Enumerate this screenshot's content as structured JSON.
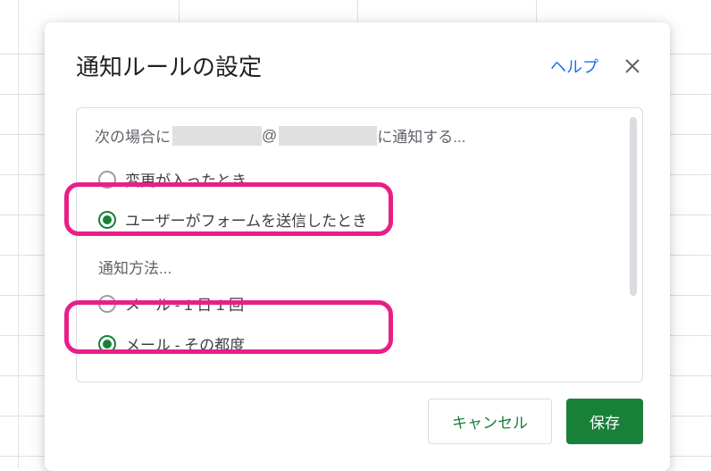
{
  "dialog": {
    "title": "通知ルールの設定",
    "help_label": "ヘルプ",
    "notify_prefix": "次の場合に",
    "notify_at": "@",
    "notify_suffix": " に通知する...",
    "trigger": {
      "options": [
        {
          "label": "変更が入ったとき",
          "selected": false
        },
        {
          "label": "ユーザーがフォームを送信したとき",
          "selected": true
        }
      ]
    },
    "method_label": "通知方法...",
    "method": {
      "options": [
        {
          "label": "メール - 1 日 1 回",
          "selected": false
        },
        {
          "label": "メール - その都度",
          "selected": true
        }
      ]
    },
    "cancel_label": "キャンセル",
    "save_label": "保存"
  },
  "colors": {
    "accent_green": "#188038",
    "link_blue": "#1a73e8",
    "highlight_pink": "#e91e89"
  }
}
